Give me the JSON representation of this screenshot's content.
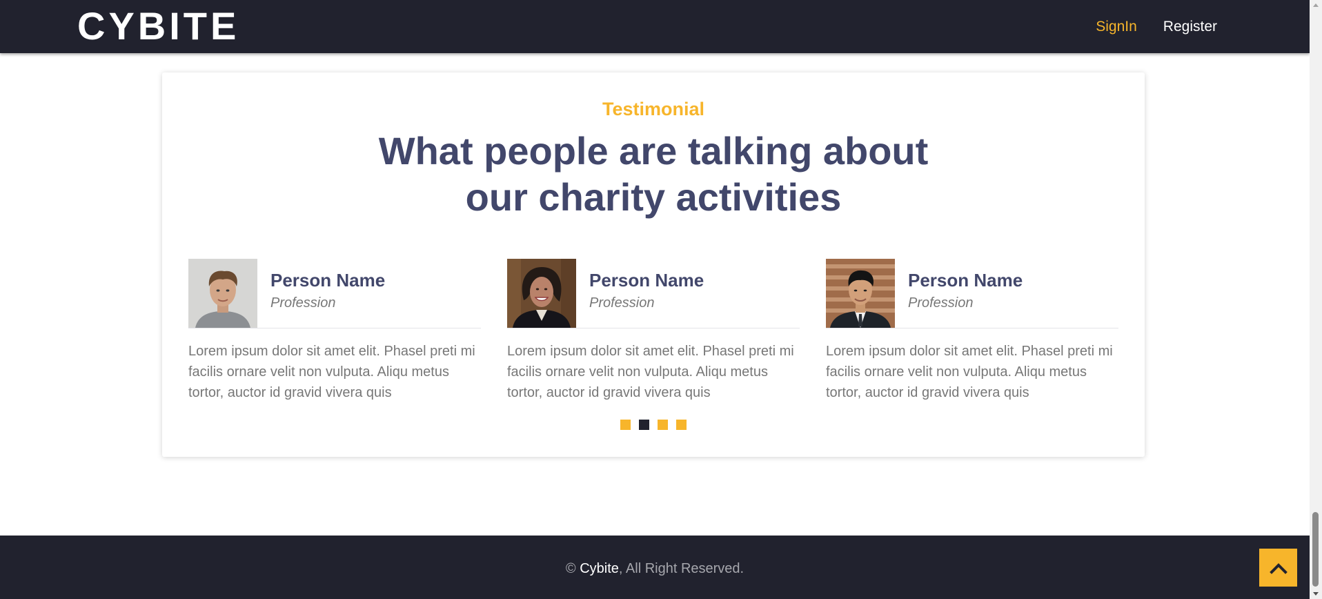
{
  "header": {
    "brand": "CYBITE",
    "nav": {
      "signin": "SignIn",
      "register": "Register"
    }
  },
  "testimonial": {
    "eyebrow": "Testimonial",
    "headline_line1": "What people are talking about",
    "headline_line2": "our charity activities",
    "items": [
      {
        "name": "Person Name",
        "profession": "Profession",
        "quote": "Lorem ipsum dolor sit amet elit. Phasel preti mi facilis ornare velit non vulputa. Aliqu metus tortor, auctor id gravid vivera quis",
        "photo": "young-man-photo"
      },
      {
        "name": "Person Name",
        "profession": "Profession",
        "quote": "Lorem ipsum dolor sit amet elit. Phasel preti mi facilis ornare velit non vulputa. Aliqu metus tortor, auctor id gravid vivera quis",
        "photo": "smiling-woman-photo"
      },
      {
        "name": "Person Name",
        "profession": "Profession",
        "quote": "Lorem ipsum dolor sit amet elit. Phasel preti mi facilis ornare velit non vulputa. Aliqu metus tortor, auctor id gravid vivera quis",
        "photo": "businessman-photo"
      }
    ],
    "carousel": {
      "dot_count": 4,
      "active_index": 1
    }
  },
  "footer": {
    "copyright_symbol": "©",
    "brand_link": "Cybite",
    "rights_text": ", All Right Reserved."
  },
  "back_to_top": {
    "icon": "chevron-up-icon"
  },
  "colors": {
    "dark": "#21222e",
    "accent": "#f7b52b",
    "heading": "#42476b",
    "body_text": "#777777",
    "footer_text": "#a6a7ad"
  }
}
